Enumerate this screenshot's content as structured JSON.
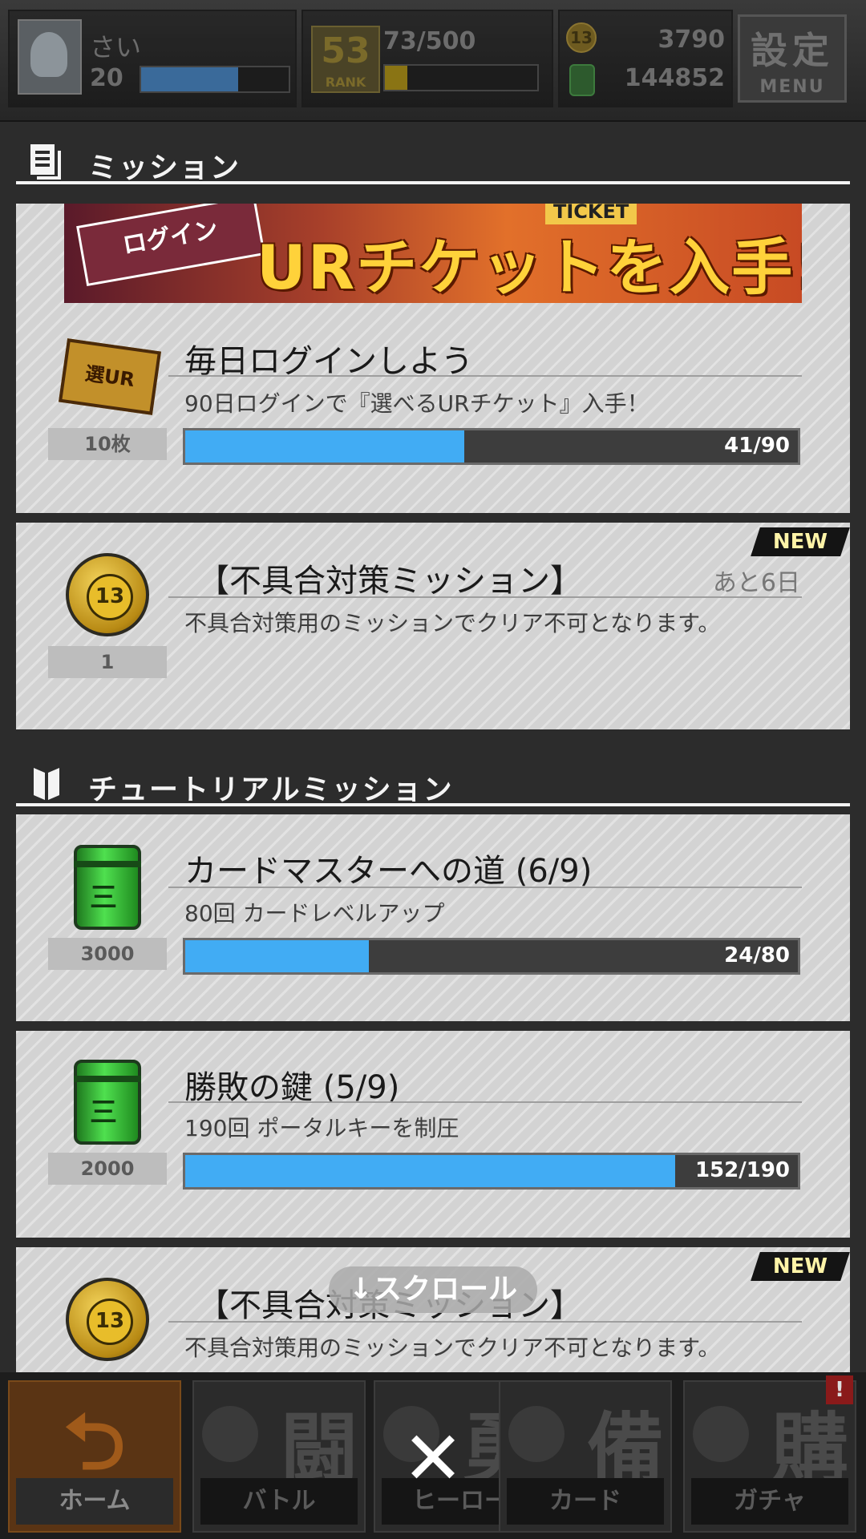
{
  "topbar": {
    "player_name": "さい",
    "player_level": "20",
    "level_progress": 0.66,
    "rank_number": "53",
    "rank_word": "RANK",
    "rank_progress_text": "73/500",
    "rank_progress": 0.146,
    "coins": "3790",
    "coin_glyph": "13",
    "drums": "144852",
    "menu_kanji": "設定",
    "menu_label": "MENU"
  },
  "mission_section": {
    "title": "ミッション"
  },
  "banner": {
    "left_text": "ログイン",
    "tag": "TICKET",
    "main_text": "URチケットを入手!"
  },
  "missions": [
    {
      "title": "毎日ログインしよう",
      "description": "90日ログインで『選べるURチケット』入手！",
      "reward_icon": "ur-ticket-icon",
      "reward_icon_text": "選UR",
      "reward_qty": "10枚",
      "progress_text": "41/90",
      "progress": 0.456
    },
    {
      "title": "【不具合対策ミッション】",
      "description": "不具合対策用のミッションでクリア不可となります。",
      "remaining": "あと6日",
      "badge": "NEW",
      "reward_icon": "coin-icon",
      "reward_qty": "1"
    }
  ],
  "tutorial_section": {
    "title": "チュートリアルミッション"
  },
  "tutorial_missions": [
    {
      "title": "カードマスターへの道 (6/9)",
      "description": "80回 カードレベルアップ",
      "reward_icon": "drum-icon",
      "reward_qty": "3000",
      "progress_text": "24/80",
      "progress": 0.3
    },
    {
      "title": "勝敗の鍵 (5/9)",
      "description": "190回 ポータルキーを制圧",
      "reward_icon": "drum-icon",
      "reward_qty": "2000",
      "progress_text": "152/190",
      "progress": 0.8
    },
    {
      "title": "【不具合対策ミッション】",
      "description": "不具合対策用のミッションでクリア不可となります。",
      "badge": "NEW",
      "reward_icon": "coin-icon"
    }
  ],
  "scroll_hint": "↓スクロール",
  "bottom_nav": [
    {
      "glyph": "⮌",
      "label": "ホーム"
    },
    {
      "glyph": "闘",
      "label": "バトル"
    },
    {
      "glyph": "勇",
      "label": "ヒーロー"
    },
    {
      "glyph": "備",
      "label": "カード"
    },
    {
      "glyph": "購",
      "label": "ガチャ",
      "alert": "!"
    }
  ],
  "close_glyph": "✕",
  "colors": {
    "progress_fill": "#41acf4",
    "card_bg": "#d3d3d3",
    "new_badge_text": "#fff4a8",
    "level_bar": "#3a6a9a",
    "rank_bar": "#8a7414"
  }
}
